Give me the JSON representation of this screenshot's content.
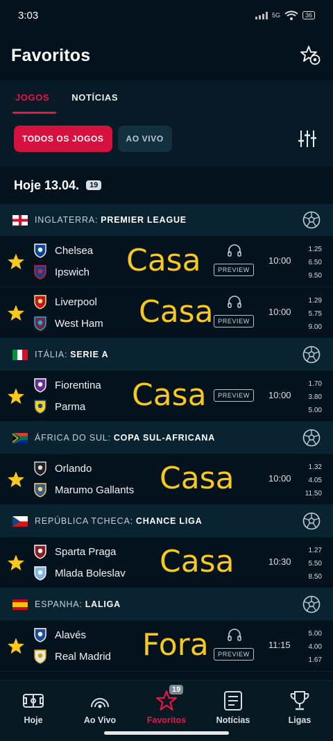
{
  "status_bar": {
    "time": "3:03",
    "net_label": "5G",
    "battery": "36"
  },
  "header": {
    "title": "Favoritos"
  },
  "tabs": [
    {
      "label": "JOGOS",
      "active": true
    },
    {
      "label": "NOTÍCIAS",
      "active": false
    }
  ],
  "filters": [
    {
      "label": "TODOS OS JOGOS",
      "active": true
    },
    {
      "label": "AO VIVO",
      "active": false
    }
  ],
  "date": {
    "label": "Hoje 13.04.",
    "count": "19"
  },
  "preview_label": "PREVIEW",
  "leagues": [
    {
      "country": "INGLATERRA:",
      "name": "PREMIER LEAGUE",
      "flag": "england",
      "matches": [
        {
          "home": "Chelsea",
          "away": "Ipswich",
          "pick": "Casa",
          "time": "10:00",
          "odds": [
            "1.25",
            "6.50",
            "9.50"
          ],
          "audio": true,
          "preview": true
        },
        {
          "home": "Liverpool",
          "away": "West Ham",
          "pick": "Casa",
          "time": "10:00",
          "odds": [
            "1.29",
            "5.75",
            "9.00"
          ],
          "audio": true,
          "preview": true
        }
      ]
    },
    {
      "country": "ITÁLIA:",
      "name": "SERIE A",
      "flag": "italy",
      "matches": [
        {
          "home": "Fiorentina",
          "away": "Parma",
          "pick": "Casa",
          "time": "10:00",
          "odds": [
            "1.70",
            "3.80",
            "5.00"
          ],
          "audio": false,
          "preview": true
        }
      ]
    },
    {
      "country": "ÁFRICA DO SUL:",
      "name": "COPA SUL-AFRICANA",
      "flag": "south-africa",
      "matches": [
        {
          "home": "Orlando",
          "away": "Marumo Gallants",
          "pick": "Casa",
          "time": "10:00",
          "odds": [
            "1.32",
            "4.05",
            "11.50"
          ],
          "audio": false,
          "preview": false
        }
      ]
    },
    {
      "country": "REPÚBLICA TCHECA:",
      "name": "CHANCE LIGA",
      "flag": "czech",
      "matches": [
        {
          "home": "Sparta Praga",
          "away": "Mlada Boleslav",
          "pick": "Casa",
          "time": "10:30",
          "odds": [
            "1.27",
            "5.50",
            "8.50"
          ],
          "audio": false,
          "preview": false
        }
      ]
    },
    {
      "country": "ESPANHA:",
      "name": "LALIGA",
      "flag": "spain",
      "matches": [
        {
          "home": "Alavés",
          "away": "Real Madrid",
          "pick": "Fora",
          "time": "11:15",
          "odds": [
            "5.00",
            "4.00",
            "1.67"
          ],
          "audio": true,
          "preview": true
        }
      ]
    }
  ],
  "bottom_nav": [
    {
      "label": "Hoje",
      "icon": "pitch-icon",
      "active": false
    },
    {
      "label": "Ao Vivo",
      "icon": "live-signal-icon",
      "active": false
    },
    {
      "label": "Favoritos",
      "icon": "star-icon",
      "active": true,
      "badge": "19"
    },
    {
      "label": "Notícias",
      "icon": "news-icon",
      "active": false
    },
    {
      "label": "Ligas",
      "icon": "trophy-icon",
      "active": false
    }
  ],
  "colors": {
    "background": "#03121c",
    "accent": "#e8174a",
    "pick": "#f7c81d",
    "star": "#f7c81d"
  }
}
